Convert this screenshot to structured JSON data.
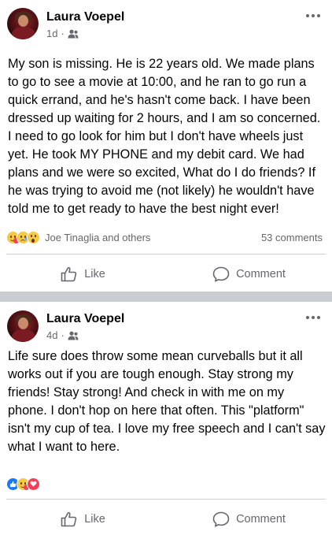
{
  "posts": [
    {
      "author": "Laura Voepel",
      "time": "1d",
      "audience_icon": "friends-icon",
      "body": "My son is missing.  He is 22 years old.  We made plans to go to see a movie at 10:00, and he ran to go run a quick errand, and he's hasn't come back.  I have been dressed up waiting for 2 hours, and I am so concerned.  I need to go look for him but I don't have wheels just yet.  He took MY PHONE and my debit card.  We had plans and we were so excited,  What do I do friends?  If he was trying to avoid me (not likely) he wouldn't have told me to get ready to have the best night ever!",
      "reactions": [
        "care",
        "sad",
        "wow"
      ],
      "reactors": "Joe Tinaglia and others",
      "comments": "53 comments",
      "like_label": "Like",
      "comment_label": "Comment"
    },
    {
      "author": "Laura Voepel",
      "time": "4d",
      "audience_icon": "friends-icon",
      "body": "Life sure does throw some mean curveballs but it all works out if you are tough enough.  Stay strong my friends!  Stay strong!  And check in with me on my phone.  I don't hop on here that often.  This \"platform\" isn't my cup of tea.  I love my free speech and I can't say what I want to here.",
      "reactions": [
        "like",
        "care",
        "love"
      ],
      "reactors": "",
      "comments": "",
      "like_label": "Like",
      "comment_label": "Comment"
    }
  ],
  "colors": {
    "text": "#050505",
    "secondary": "#65676b",
    "divider": "#c9ccd1",
    "like_blue": "#1877f2",
    "love_red": "#f33e58",
    "emoji_yellow": "#f7c843"
  }
}
